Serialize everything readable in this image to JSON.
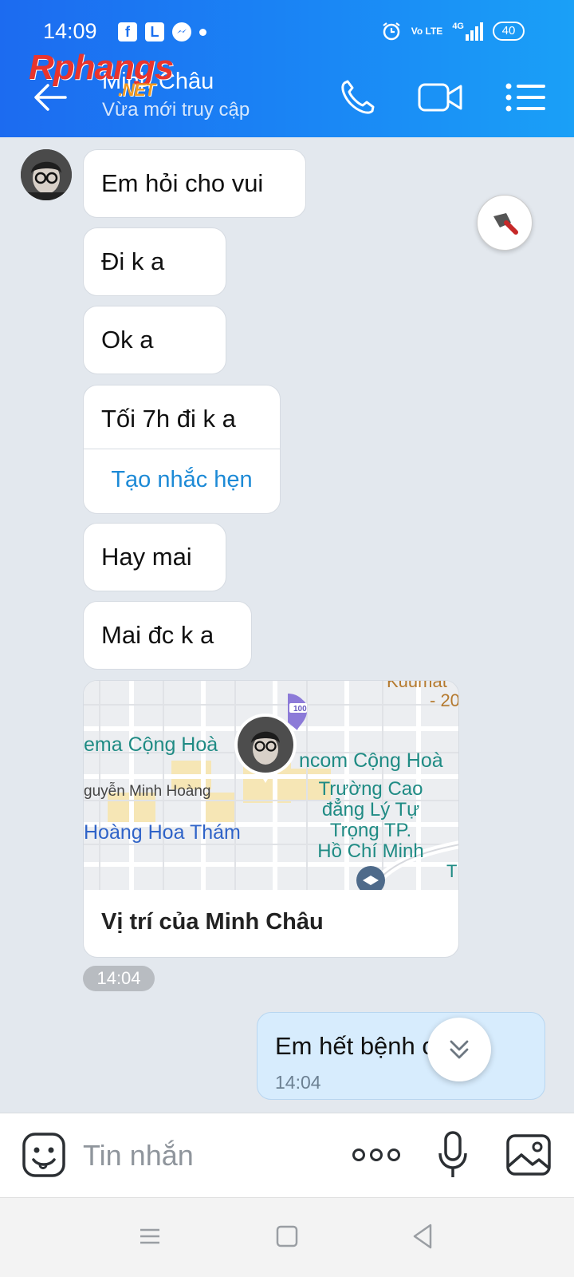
{
  "status_bar": {
    "time": "14:09",
    "app_icons": [
      "facebook-icon",
      "letter-l-icon",
      "messenger-icon"
    ],
    "volte": "Vo LTE",
    "network": "4G",
    "battery": "40"
  },
  "header": {
    "watermark": "Rphangs",
    "watermark_suffix": ".NET",
    "contact_name": "Minh Châu",
    "contact_status": "Vừa mới truy cập",
    "accent_color": "#1a86f5"
  },
  "messages": {
    "m1": "Em hỏi cho vui",
    "m2": "Đi k a",
    "m3": "Ok a",
    "m4": "Tối 7h đi k a",
    "m4_action": "Tạo nhắc hẹn",
    "m5": "Hay mai",
    "m6": "Mai đc k a",
    "location_caption": "Vị trí của Minh Châu",
    "received_time": "14:04",
    "sent_text": "Em hết bệnh chu",
    "sent_time": "14:04"
  },
  "map": {
    "labels": [
      "ema Cộng Hoà",
      "ncom Cộng Hoà",
      "guyễn Minh Hoàng",
      "Hoàng Hoa Thám",
      "Trường Cao",
      "đẳng Lý Tự",
      "Trọng TP.",
      "Hồ Chí Minh",
      "Kuumat",
      "- 20",
      "T"
    ],
    "pin_badge": "100"
  },
  "input": {
    "placeholder": "Tin nhắn"
  }
}
